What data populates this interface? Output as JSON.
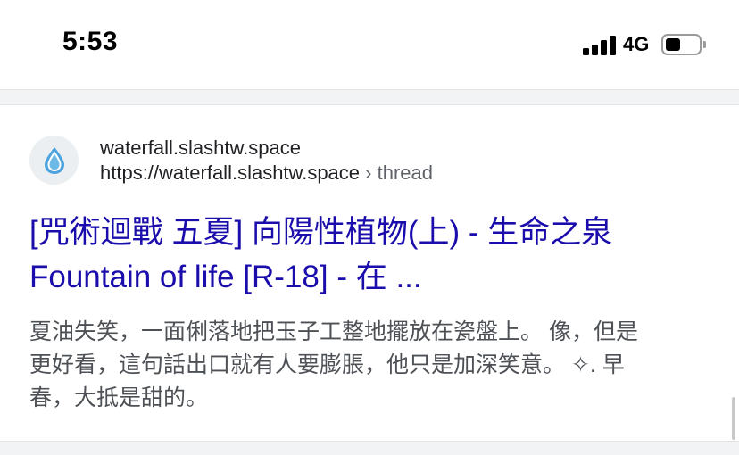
{
  "status_bar": {
    "time": "5:53",
    "network": "4G",
    "battery_level": 0.4,
    "signal_bars": 4
  },
  "result": {
    "favicon": "water-drop-icon",
    "site_name": "waterfall.slashtw.space",
    "url": "https://waterfall.slashtw.space",
    "url_separator": "›",
    "breadcrumb": "thread",
    "title_lines": [
      "[咒術迴戰 五夏] 向陽性植物(上) - 生命之泉",
      "Fountain of life [R-18] - 在 ..."
    ],
    "snippet_lines": [
      "夏油失笑，一面俐落地把玉子工整地擺放在瓷盤上。 像，但是",
      "更好看，這句話出口就有人要膨脹，他只是加深笑意。 ✧. 早",
      "春，大抵是甜的。"
    ]
  },
  "colors": {
    "link": "#1a0dab",
    "text": "#202124",
    "muted": "#4d5156",
    "divider": "#f1f3f4",
    "favicon": "#4aa3df"
  }
}
